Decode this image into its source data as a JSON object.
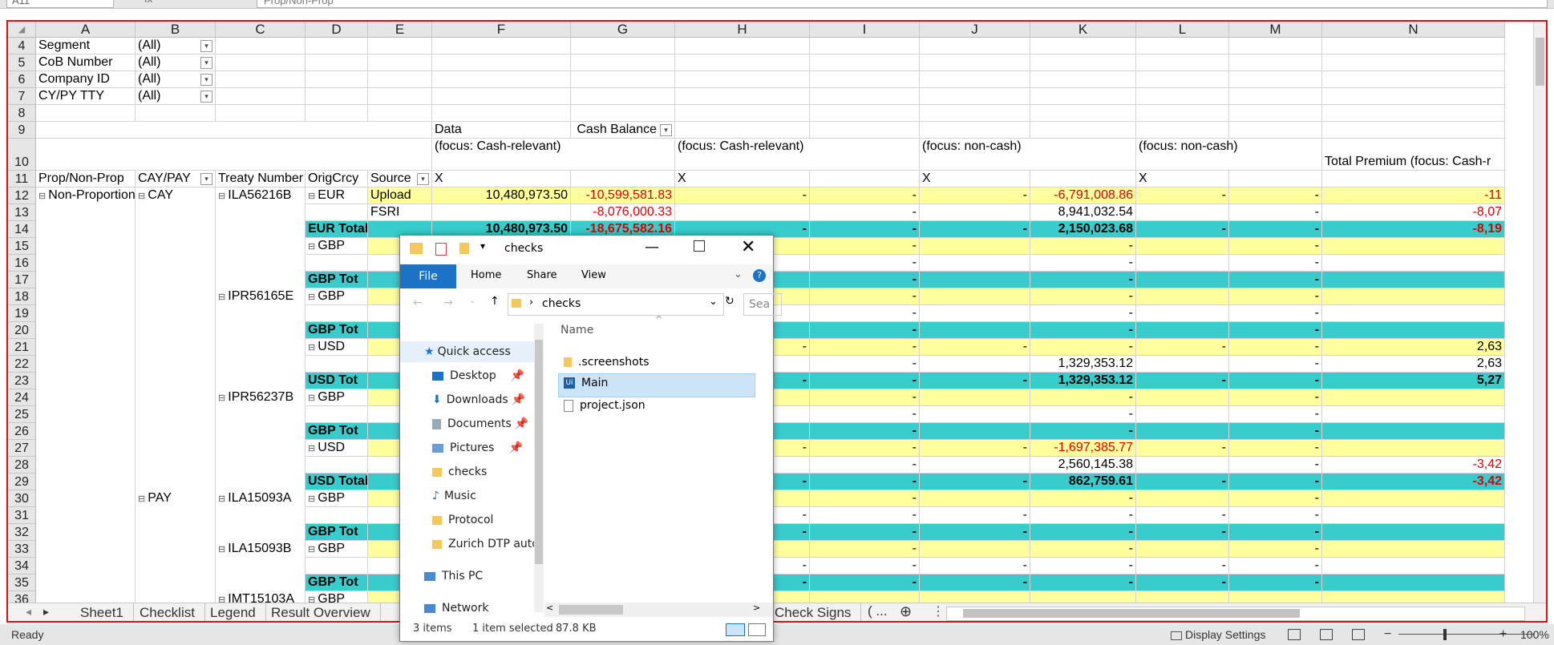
{
  "formula_bar": {
    "name_box": "A11",
    "fx": "fx",
    "content": "Prop/Non-Prop"
  },
  "columns": [
    "A",
    "B",
    "C",
    "D",
    "E",
    "F",
    "G",
    "H",
    "I",
    "J",
    "K",
    "L",
    "M",
    "N"
  ],
  "filters": [
    {
      "row": "4",
      "label": "Segment",
      "value": "(All)"
    },
    {
      "row": "5",
      "label": "CoB Number",
      "value": "(All)"
    },
    {
      "row": "6",
      "label": "Company ID",
      "value": "(All)"
    },
    {
      "row": "7",
      "label": "CY/PY TTY",
      "value": "(All)"
    }
  ],
  "pivot": {
    "data_label": "Data",
    "cash_balance_label": "Cash Balance",
    "focus_cash_relevant": "(focus: Cash-relevant)",
    "focus_non_cash": "(focus: non-cash)",
    "total_premium": "Total Premium (focus: Cash-r",
    "x_mark": "X",
    "headers": [
      "Prop/Non-Prop",
      "CAY/PAY",
      "Treaty Number",
      "OrigCrcy",
      "Source"
    ]
  },
  "rows": [
    {
      "r": "12",
      "a": "Non-Proportional",
      "b": "CAY",
      "c": "ILA56216B",
      "d": "EUR",
      "e": "Upload",
      "f": "10,480,973.50",
      "g": "-10,599,581.83",
      "h": "-",
      "i": "-",
      "j": "-",
      "k": "-6,791,008.86",
      "l": "-",
      "m": "-",
      "n": "-11",
      "style": "yel"
    },
    {
      "r": "13",
      "e": "FSRI",
      "g": "-8,076,000.33",
      "i": "-",
      "k": "8,941,032.54",
      "m": "-",
      "n": "-8,07",
      "style": "white"
    },
    {
      "r": "14",
      "d": "EUR Total",
      "f": "10,480,973.50",
      "g": "-18,675,582.16",
      "h": "-",
      "i": "-",
      "j": "-",
      "k": "2,150,023.68",
      "l": "-",
      "m": "-",
      "n": "-8,19",
      "style": "teal"
    },
    {
      "r": "15",
      "d": "GBP",
      "i": "-",
      "k": "-",
      "m": "-",
      "style": "yel"
    },
    {
      "r": "16",
      "i": "-",
      "k": "-",
      "m": "-",
      "style": "white"
    },
    {
      "r": "17",
      "d": "GBP Tot",
      "i": "-",
      "k": "-",
      "m": "-",
      "style": "teal"
    },
    {
      "r": "18",
      "c": "IPR56165E",
      "d": "GBP",
      "i": "-",
      "k": "-",
      "m": "-",
      "style": "yel"
    },
    {
      "r": "19",
      "i": "-",
      "k": "-",
      "m": "-",
      "style": "white"
    },
    {
      "r": "20",
      "d": "GBP Tot",
      "i": "-",
      "k": "-",
      "m": "-",
      "style": "teal"
    },
    {
      "r": "21",
      "d": "USD",
      "h": "-",
      "i": "-",
      "j": "-",
      "k": "-",
      "l": "-",
      "m": "-",
      "n": "2,63",
      "style": "yel"
    },
    {
      "r": "22",
      "i": "-",
      "k": "1,329,353.12",
      "m": "-",
      "n": "2,63",
      "style": "white"
    },
    {
      "r": "23",
      "d": "USD Tot",
      "h": "-",
      "i": "-",
      "j": "-",
      "k": "1,329,353.12",
      "l": "-",
      "m": "-",
      "n": "5,27",
      "style": "teal"
    },
    {
      "r": "24",
      "c": "IPR56237B",
      "d": "GBP",
      "i": "-",
      "k": "-",
      "m": "-",
      "style": "yel"
    },
    {
      "r": "25",
      "i": "-",
      "k": "-",
      "m": "-",
      "style": "white"
    },
    {
      "r": "26",
      "d": "GBP Tot",
      "i": "-",
      "k": "-",
      "m": "-",
      "style": "teal"
    },
    {
      "r": "27",
      "d": "USD",
      "h": "-",
      "i": "-",
      "j": "-",
      "k": "-1,697,385.77",
      "l": "-",
      "m": "-",
      "style": "yel"
    },
    {
      "r": "28",
      "i": "-",
      "k": "2,560,145.38",
      "m": "-",
      "n": "-3,42",
      "style": "white"
    },
    {
      "r": "29",
      "d": "USD Total",
      "h": "-",
      "i": "-",
      "j": "-",
      "k": "862,759.61",
      "l": "-",
      "m": "-",
      "n": "-3,42",
      "style": "teal"
    },
    {
      "r": "30",
      "b": "PAY",
      "c": "ILA15093A",
      "d": "GBP",
      "i": "-",
      "k": "-",
      "m": "-",
      "style": "yel"
    },
    {
      "r": "31",
      "h": "-",
      "i": "-",
      "j": "-",
      "k": "-",
      "l": "-",
      "m": "-",
      "style": "white"
    },
    {
      "r": "32",
      "d": "GBP Tot",
      "h": "-",
      "i": "-",
      "j": "-",
      "k": "-",
      "l": "-",
      "m": "-",
      "style": "teal"
    },
    {
      "r": "33",
      "c": "ILA15093B",
      "d": "GBP",
      "i": "-",
      "k": "-",
      "m": "-",
      "style": "yel"
    },
    {
      "r": "34",
      "h": "-",
      "i": "-",
      "j": "-",
      "k": "-",
      "l": "-",
      "m": "-",
      "style": "white"
    },
    {
      "r": "35",
      "d": "GBP Tot",
      "h": "-",
      "i": "-",
      "j": "-",
      "k": "-",
      "l": "-",
      "m": "-",
      "style": "teal"
    },
    {
      "r": "36",
      "c": "IMT15103A",
      "d": "GBP",
      "style": "yel"
    }
  ],
  "tabs": [
    "Sheet1",
    "Checklist",
    "Legend",
    "Result Overview",
    "Check Signs"
  ],
  "status": {
    "ready": "Ready",
    "display_settings": "Display Settings",
    "zoom": "100%"
  },
  "explorer": {
    "title": "checks",
    "ribbon": [
      "File",
      "Home",
      "Share",
      "View"
    ],
    "address": "checks",
    "search_placeholder": "Sea",
    "nav": [
      "Quick access",
      "Desktop",
      "Downloads",
      "Documents",
      "Pictures",
      "checks",
      "Music",
      "Protocol",
      "Zurich DTP autor",
      "This PC",
      "Network"
    ],
    "column_name": "Name",
    "files": [
      ".screenshots",
      "Main",
      "project.json"
    ],
    "status_items": "3 items",
    "status_selected": "1 item selected",
    "status_size": "87.8 KB"
  }
}
